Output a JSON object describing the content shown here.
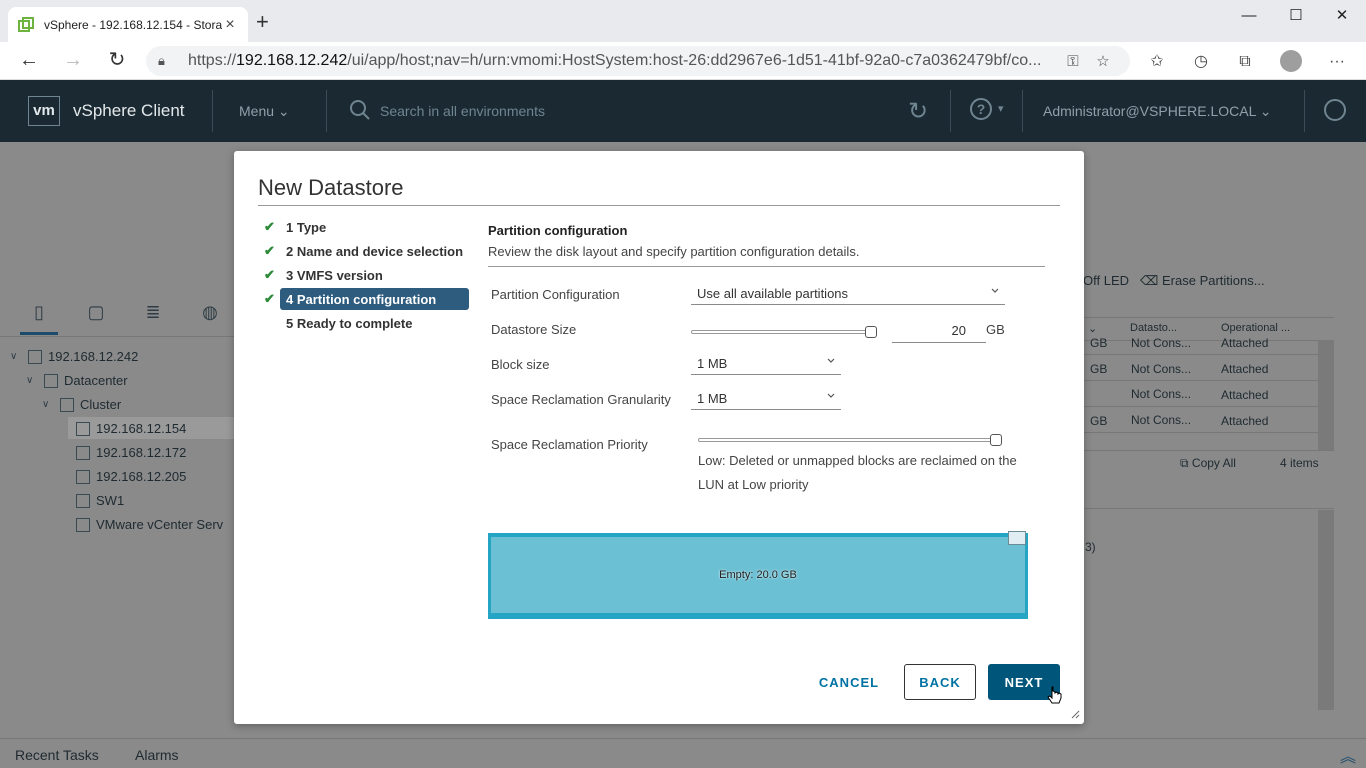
{
  "browser": {
    "tab_title": "vSphere - 192.168.12.154 - Stora",
    "url_prefix": "https://",
    "url_host": "192.168.12.242",
    "url_rest": "/ui/app/host;nav=h/urn:vmomi:HostSystem:host-26:dd2967e6-1d51-41bf-92a0-c7a0362479bf/co...",
    "window_controls": [
      "minimize",
      "maximize",
      "close"
    ]
  },
  "header": {
    "logo": "vm",
    "app_title": "vSphere Client",
    "menu_label": "Menu",
    "search_placeholder": "Search in all environments",
    "user": "Administrator@VSPHERE.LOCAL",
    "brand_color": "#1b2a32"
  },
  "navigator": {
    "tree": [
      {
        "label": "192.168.12.242",
        "icon": "vcenter-icon"
      },
      {
        "label": "Datacenter",
        "icon": "datacenter-icon"
      },
      {
        "label": "Cluster",
        "icon": "cluster-icon"
      },
      {
        "label": "192.168.12.154",
        "icon": "host-icon",
        "selected": true
      },
      {
        "label": "192.168.12.172",
        "icon": "host-icon"
      },
      {
        "label": "192.168.12.205",
        "icon": "host-icon"
      },
      {
        "label": "SW1",
        "icon": "vm-icon"
      },
      {
        "label": "VMware vCenter Serv",
        "icon": "vm-icon"
      }
    ]
  },
  "background": {
    "toolbar_off_led": "Off LED",
    "toolbar_erase": "Erase Partitions...",
    "col_datastore": "Datasto...",
    "col_operational": "Operational ...",
    "rows": [
      {
        "size": "GB",
        "datastore": "Not Cons...",
        "state": "Attached"
      },
      {
        "size": "GB",
        "datastore": "Not Cons...",
        "state": "Attached"
      },
      {
        "size": "",
        "datastore": "Not Cons...",
        "state": "Attached"
      },
      {
        "size": "GB",
        "datastore": "Not Cons...",
        "state": "Attached"
      }
    ],
    "copy_all": "Copy All",
    "item_count": "4 items",
    "fragment": "3)"
  },
  "bottom": {
    "recent_tasks": "Recent Tasks",
    "alarms": "Alarms"
  },
  "modal": {
    "title": "New Datastore",
    "steps": [
      {
        "label": "1 Type",
        "done": true
      },
      {
        "label": "2 Name and device selection",
        "done": true
      },
      {
        "label": "3 VMFS version",
        "done": true
      },
      {
        "label": "4 Partition configuration",
        "done": true,
        "active": true
      },
      {
        "label": "5 Ready to complete",
        "done": false
      }
    ],
    "section_title": "Partition configuration",
    "section_desc": "Review the disk layout and specify partition configuration details.",
    "fields": {
      "partition_config_label": "Partition Configuration",
      "partition_config_value": "Use all available partitions",
      "datastore_size_label": "Datastore Size",
      "datastore_size_value": "20",
      "datastore_size_unit": "GB",
      "datastore_size_slider_fraction": 1.0,
      "block_size_label": "Block size",
      "block_size_value": "1 MB",
      "granularity_label": "Space Reclamation Granularity",
      "granularity_value": "1 MB",
      "priority_label": "Space Reclamation Priority",
      "priority_slider_fraction": 1.0,
      "priority_desc": "Low: Deleted or unmapped blocks are reclaimed on the LUN at Low priority"
    },
    "partition_label": "Empty: 20.0 GB",
    "partition_color": "#6cc0d4",
    "buttons": {
      "cancel": "CANCEL",
      "back": "BACK",
      "next": "NEXT"
    },
    "accent_color": "#00567a"
  }
}
